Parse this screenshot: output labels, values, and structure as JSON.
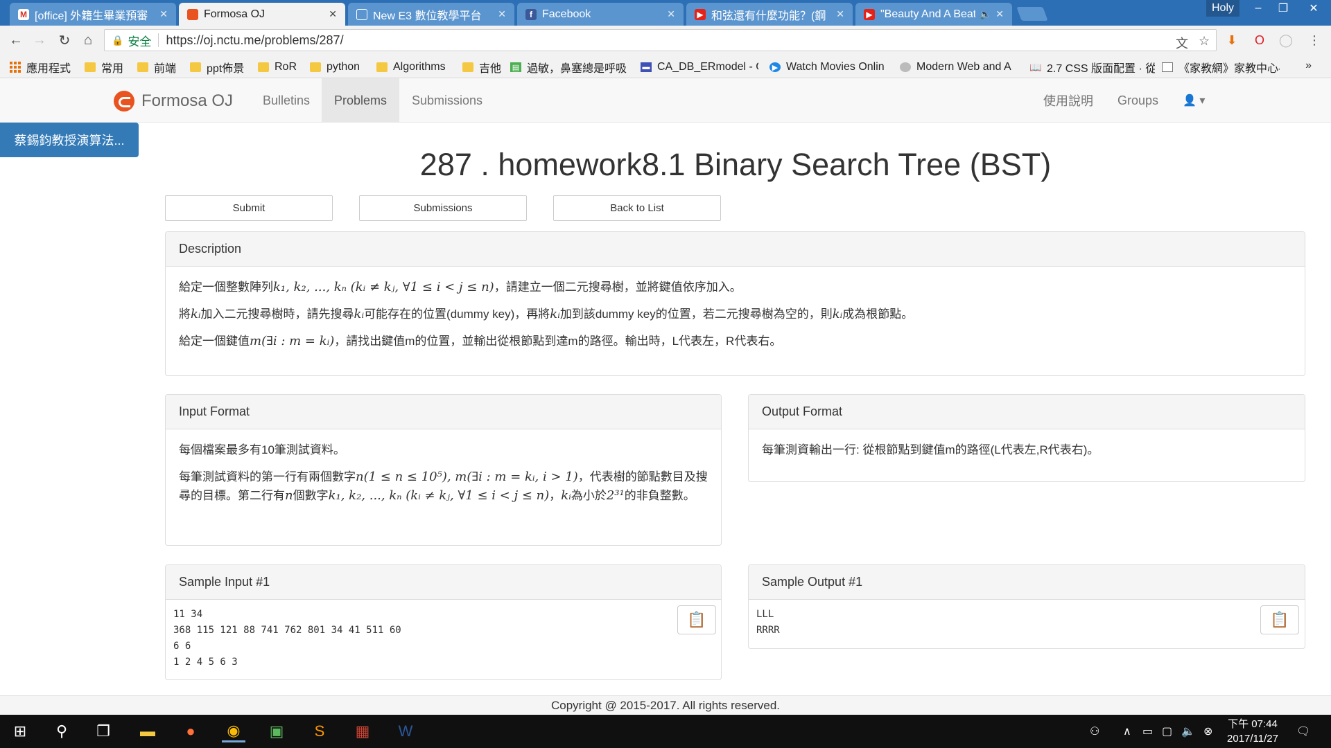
{
  "browser": {
    "tabs": [
      {
        "label": "[office] 外籍生畢業預審",
        "icon": "gmail-icon",
        "active": false
      },
      {
        "label": "Formosa OJ",
        "icon": "formosa-oj-icon",
        "active": true
      },
      {
        "label": "New E3 數位教學平台",
        "icon": "document-icon",
        "active": false
      },
      {
        "label": "Facebook",
        "icon": "facebook-icon",
        "active": false
      },
      {
        "label": "和弦還有什麼功能？(鋼",
        "icon": "youtube-icon",
        "active": false
      },
      {
        "label": "\"Beauty And A Beat\"",
        "icon": "youtube-icon",
        "active": false
      }
    ],
    "profile_name": "Holy",
    "secure_label": "安全",
    "url": "https://oj.nctu.me/problems/287/",
    "bookmarks": [
      {
        "label": "應用程式",
        "icon": "apps-icon"
      },
      {
        "label": "常用",
        "icon": "folder-icon"
      },
      {
        "label": "前端",
        "icon": "folder-icon"
      },
      {
        "label": "ppt佈景",
        "icon": "folder-icon"
      },
      {
        "label": "RoR",
        "icon": "folder-icon"
      },
      {
        "label": "python",
        "icon": "folder-icon"
      },
      {
        "label": "Algorithms",
        "icon": "folder-icon"
      },
      {
        "label": "吉他",
        "icon": "folder-icon"
      },
      {
        "label": "過敏，鼻塞總是呼吸",
        "icon": "page-icon"
      },
      {
        "label": "CA_DB_ERmodel - G",
        "icon": "doc-icon"
      },
      {
        "label": "Watch Movies Onlin",
        "icon": "play-icon"
      },
      {
        "label": "Modern Web and A",
        "icon": "globe-icon"
      },
      {
        "label": "2.7 CSS 版面配置 · 從",
        "icon": "book-icon"
      },
      {
        "label": "《家教網》家教中心-",
        "icon": "page-icon"
      }
    ],
    "bookmarks_more": "»"
  },
  "site": {
    "brand": "Formosa OJ",
    "nav": [
      {
        "label": "Bulletins",
        "active": false
      },
      {
        "label": "Problems",
        "active": true
      },
      {
        "label": "Submissions",
        "active": false
      }
    ],
    "nav_right": [
      {
        "label": "使用說明"
      },
      {
        "label": "Groups"
      }
    ],
    "side_tab": "蔡錫鈞教授演算法..."
  },
  "problem": {
    "title": "287 . homework8.1 Binary Search Tree (BST)",
    "buttons": {
      "submit": "Submit",
      "submissions": "Submissions",
      "back": "Back to List"
    },
    "description": {
      "heading": "Description",
      "p1": {
        "a": "給定一個整數陣列",
        "m1": "k₁, k₂, ..., kₙ (kᵢ ≠ kⱼ, ∀1 ≤ i < j ≤ n)",
        "b": "，請建立一個二元搜尋樹，並將鍵值依序加入。"
      },
      "p2": {
        "a": "將",
        "m1": "kᵢ",
        "b": "加入二元搜尋樹時，請先搜尋",
        "m2": "kᵢ",
        "c": "可能存在的位置(dummy key)，再將",
        "m3": "kᵢ",
        "d": "加到該dummy key的位置，若二元搜尋樹為空的，則",
        "m4": "kᵢ",
        "e": "成為根節點。"
      },
      "p3": {
        "a": "給定一個鍵值",
        "m1": "m(∃i : m = kᵢ)",
        "b": "，請找出鍵值m的位置，並輸出從根節點到達m的路徑。輸出時，L代表左，R代表右。"
      }
    },
    "input_format": {
      "heading": "Input Format",
      "p1": "每個檔案最多有10筆測試資料。",
      "p2": {
        "a": "每筆測試資料的第一行有兩個數字",
        "m1": "n(1 ≤ n ≤ 10⁵), m(∃i : m = kᵢ, i > 1)",
        "b": "，代表樹的節點數目及搜尋的目標。第二行有",
        "m2": "n",
        "c": "個數字",
        "m3": "k₁, k₂, ..., kₙ (kᵢ ≠ kⱼ, ∀1 ≤ i < j ≤ n)",
        "d": "，",
        "m4": "kᵢ",
        "e": "為小於",
        "m5": "2³¹",
        "f": "的非負整數。"
      }
    },
    "output_format": {
      "heading": "Output Format",
      "p1": "每筆測資輸出一行: 從根節點到鍵值m的路徑(L代表左,R代表右)。"
    },
    "sample_input": {
      "heading": "Sample Input #1",
      "lines": "11 34\n368 115 121 88 741 762 801 34 41 511 60\n6 6\n1 2 4 5 6 3"
    },
    "sample_output": {
      "heading": "Sample Output #1",
      "lines": "LLL\nRRRR"
    }
  },
  "footer": "Copyright @ 2015-2017. All rights reserved.",
  "taskbar": {
    "apps": [
      "start-icon",
      "search-icon",
      "task-view-icon",
      "file-explorer-icon",
      "firefox-icon",
      "chrome-icon",
      "app-icon",
      "sublime-icon",
      "winrar-icon",
      "word-icon"
    ],
    "time": "下午 07:44",
    "date": "2017/11/27"
  }
}
